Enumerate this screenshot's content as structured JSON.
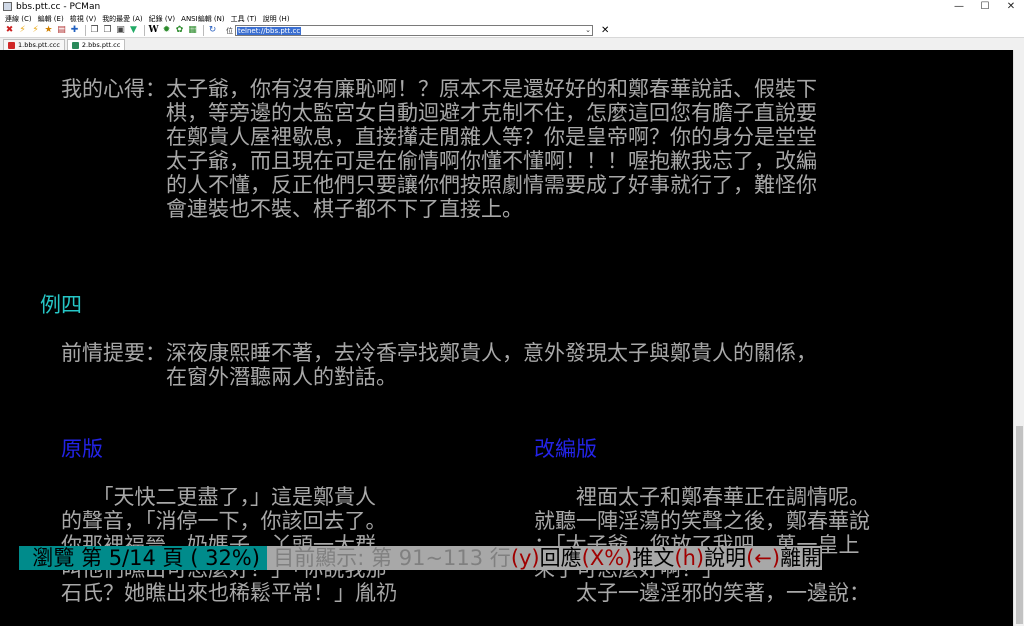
{
  "window": {
    "title": "bbs.ptt.cc - PCMan",
    "minimize": "—",
    "maximize": "☐",
    "close": "✕"
  },
  "menu": [
    "連線 (C)",
    "編輯 (E)",
    "檢視 (V)",
    "我的最愛 (A)",
    "紀錄 (V)",
    "ANSI編輯 (N)",
    "工具 (T)",
    "說明 (H)"
  ],
  "toolbar": {
    "address_label": "位",
    "address_value": "telnet://bbs.ptt.cc",
    "close_label": "✕",
    "w_label": "W"
  },
  "tabs": [
    {
      "label": "1.bbs.ptt.ccc",
      "icon": "disconnected-icon",
      "active": false
    },
    {
      "label": "2.bbs.ptt.cc",
      "icon": "connected-icon",
      "active": true
    }
  ],
  "terminal": {
    "lines": [
      {
        "text": "　　我的心得：太子爺，你有沒有廉恥啊！？原本不是還好好的和鄭春華說話、假裝下",
        "color": "gray"
      },
      {
        "text": "　　　　　　　棋，等旁邊的太監宮女自動迴避才克制不住，怎麼這回您有膽子直說要",
        "color": "gray"
      },
      {
        "text": "　　　　　　　在鄭貴人屋裡歇息，直接攆走閒雜人等？你是皇帝啊？你的身分是堂堂",
        "color": "gray"
      },
      {
        "text": "　　　　　　　太子爺，而且現在可是在偷情啊你懂不懂啊！！！喔抱歉我忘了，改編",
        "color": "gray"
      },
      {
        "text": "　　　　　　　的人不懂，反正他們只要讓你們按照劇情需要成了好事就行了，難怪你",
        "color": "gray"
      },
      {
        "text": "　　　　　　　會連裝也不裝、棋子都不下了直接上。",
        "color": "gray"
      },
      {
        "text": "",
        "color": "gray"
      },
      {
        "text": "",
        "color": "gray"
      },
      {
        "text": "",
        "color": "gray"
      },
      {
        "text": "　例四",
        "color": "cyan"
      },
      {
        "text": "",
        "color": "gray"
      },
      {
        "text": "　　前情提要：深夜康熙睡不著，去冷香亭找鄭貴人，意外發現太子與鄭貴人的關係，",
        "color": "gray"
      },
      {
        "text": "　　　　　　　在窗外潛聽兩人的對話。",
        "color": "gray"
      },
      {
        "text": "",
        "color": "gray"
      },
      {
        "text": "",
        "color": "gray"
      },
      {
        "text": "　　原版",
        "color": "blue",
        "right": "改編版",
        "right_color": "blue"
      },
      {
        "text": "",
        "color": "gray"
      },
      {
        "text": "　　　　「天快二更盡了，」這是鄭貴人",
        "color": "gray",
        "right": "　　裡面太子和鄭春華正在調情呢。",
        "right_color": "gray"
      },
      {
        "text": "　　的聲音，「消停一下，你該回去了。",
        "color": "gray",
        "right": "就聽一陣淫蕩的笑聲之後，鄭春華說",
        "right_color": "gray"
      },
      {
        "text": "　　你那裡福晉、奶媽子、丫頭一大群，",
        "color": "gray",
        "right": "：「太子爺，您放了我吧，萬一皇上",
        "right_color": "gray"
      },
      {
        "text": "　　叫他們瞧出可怎麼好？」「你說我那",
        "color": "gray",
        "right": "來了可怎麼好啊！」",
        "right_color": "gray"
      },
      {
        "text": "　　石氏？她瞧出來也稀鬆平常！」胤礽",
        "color": "gray",
        "right": "　　太子一邊淫邪的笑著，一邊說：",
        "right_color": "gray"
      }
    ]
  },
  "status_bar": {
    "browse": "  瀏覽 第 5/14 頁 ( 32%) ",
    "position": " 目前顯示: 第 91~113 行",
    "key_reply": "(y)",
    "act_reply": "回應",
    "key_push": "(X%)",
    "act_push": "推文",
    "key_help": "(h)",
    "act_help": "說明",
    "key_leave": "(←)",
    "act_leave": "離開"
  },
  "colors": {
    "terminal_bg": "#000000",
    "text_gray": "#a8a8a8",
    "heading_cyan": "#26c6c6",
    "heading_blue": "#2323e6",
    "status_cyan": "#008b8b",
    "status_key_red": "#a00000"
  }
}
